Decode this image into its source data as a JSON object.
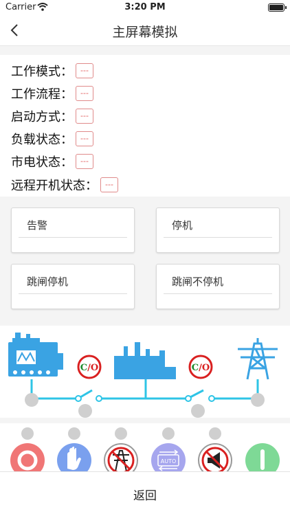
{
  "status_bar": {
    "carrier": "Carrier",
    "time": "3:20 PM"
  },
  "nav": {
    "title": "主屏幕模拟",
    "back_icon": "chevron-left-icon"
  },
  "info_rows": [
    {
      "label": "工作模式：",
      "value": "---"
    },
    {
      "label": "工作流程：",
      "value": "---"
    },
    {
      "label": "启动方式：",
      "value": "---"
    },
    {
      "label": "负载状态：",
      "value": "---"
    },
    {
      "label": "市电状态：",
      "value": "---"
    },
    {
      "label": "远程开机状态：",
      "value": "---"
    }
  ],
  "alarm_cards": [
    {
      "label": "告警"
    },
    {
      "label": "停机"
    },
    {
      "label": "跳闸停机"
    },
    {
      "label": "跳闸不停机"
    }
  ],
  "diagram": {
    "switch_label_1": "C/O",
    "switch_label_2": "C/O",
    "colors": {
      "line": "#2ec4e6",
      "equipment": "#3aa3e3",
      "dot": "#cfcfcf",
      "switch_red": "#d92020",
      "switch_green": "#1a8a2a"
    }
  },
  "control_buttons": [
    {
      "icon": "stop-icon",
      "color": "#f07676"
    },
    {
      "icon": "hand-icon",
      "color": "#7aa0ee"
    },
    {
      "icon": "grid-tower-disabled-icon",
      "color": "#ffffff"
    },
    {
      "icon": "auto-icon",
      "color": "#a6a6ee",
      "text": "AUTO"
    },
    {
      "icon": "horn-mute-icon",
      "color": "#ffffff"
    },
    {
      "icon": "start-icon",
      "color": "#7ed996"
    }
  ],
  "footer": {
    "back_label": "返回"
  }
}
